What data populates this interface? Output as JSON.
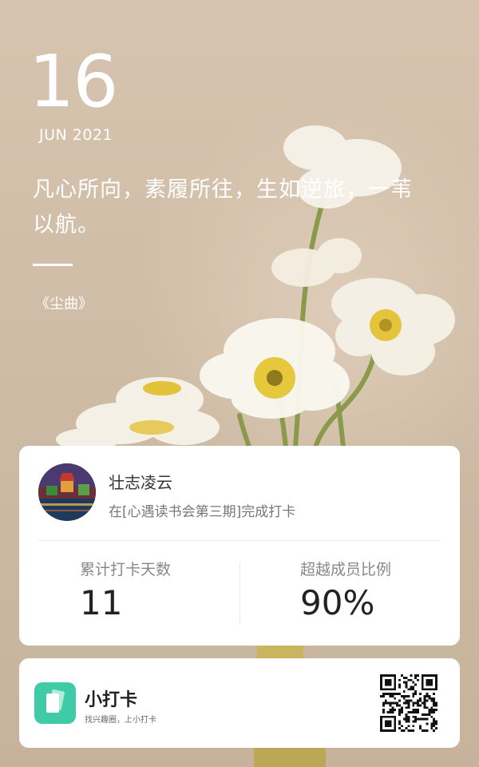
{
  "date": {
    "day": "16",
    "month_year": "JUN 2021"
  },
  "quote": {
    "line1": "凡心所向，素履所往，生如逆旅，一苇",
    "line2": "以航。",
    "source": "《尘曲》"
  },
  "checkin_card": {
    "user_name": "壮志凌云",
    "status_text": "在[心遇读书会第三期]完成打卡",
    "stats": [
      {
        "label": "累计打卡天数",
        "value": "11"
      },
      {
        "label": "超越成员比例",
        "value": "90%"
      }
    ]
  },
  "brand": {
    "name": "小打卡",
    "slogan": "找兴趣圈，上小打卡",
    "logo_color": "#3fcba6"
  },
  "colors": {
    "background": "#cdb9a2",
    "text_on_bg": "#ffffff",
    "accent": "#3fcba6"
  }
}
